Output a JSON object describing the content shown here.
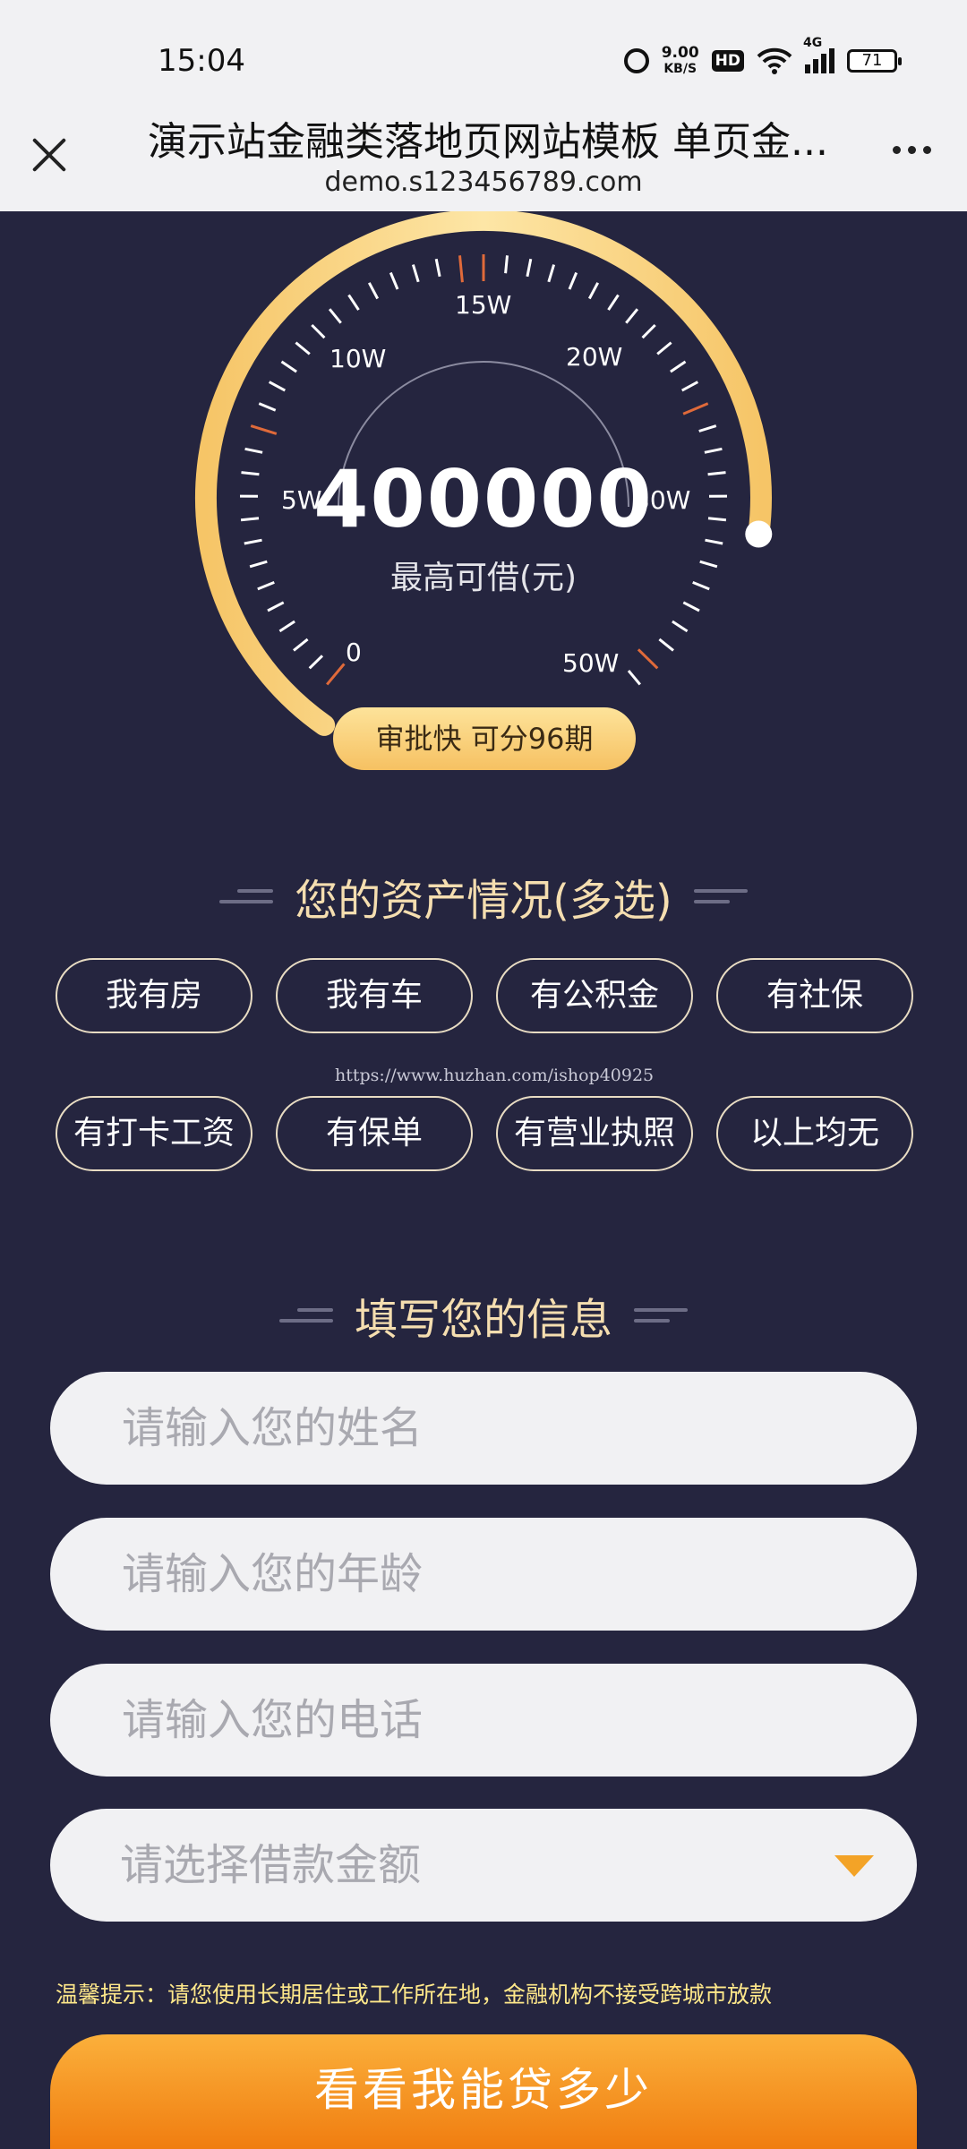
{
  "status_bar": {
    "time": "15:04",
    "net_speed_value": "9.00",
    "net_speed_unit": "KB/S",
    "hd": "HD",
    "network": "4G",
    "battery": "71",
    "icons": [
      "alarm-icon",
      "wifi-icon",
      "signal-icon",
      "battery-icon"
    ]
  },
  "browser": {
    "title": "演示站金融类落地页网站模板 单页金...",
    "url": "demo.s123456789.com",
    "close_icon": "close-icon",
    "more_icon": "more-dots-icon"
  },
  "gauge": {
    "value": "400000",
    "caption": "最高可借(元)",
    "ticks": [
      "0",
      "5W",
      "10W",
      "15W",
      "20W",
      "30W",
      "50W"
    ],
    "badge": "审批快  可分96期",
    "level_fraction": 0.97,
    "colors": {
      "arc": "#f8cd72",
      "accent_tick": "#e06a3a",
      "background": "#25253f"
    }
  },
  "assets": {
    "heading": "您的资产情况(多选)",
    "options": [
      "我有房",
      "我有车",
      "有公积金",
      "有社保",
      "有打卡工资",
      "有保单",
      "有营业执照",
      "以上均无"
    ]
  },
  "watermark": "https://www.huzhan.com/ishop40925",
  "form": {
    "heading": "填写您的信息",
    "name_placeholder": "请输入您的姓名",
    "age_placeholder": "请输入您的年龄",
    "phone_placeholder": "请输入您的电话",
    "amount_placeholder": "请选择借款金额",
    "tip": "温馨提示：请您使用长期居住或工作所在地，金融机构不接受跨城市放款",
    "submit": "看看我能贷多少"
  }
}
